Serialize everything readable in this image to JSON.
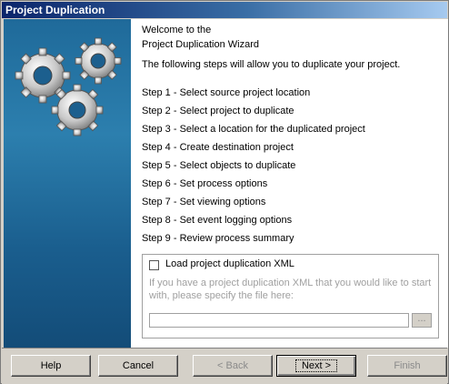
{
  "window": {
    "title": "Project Duplication"
  },
  "intro": {
    "line1": "Welcome to the",
    "line2": "Project Duplication Wizard",
    "line3": "The following steps will allow you to duplicate your project."
  },
  "steps": [
    "Step 1 - Select source project location",
    "Step 2 - Select project to duplicate",
    "Step 3 - Select a location for the duplicated project",
    "Step 4 - Create destination project",
    "Step 5 - Select objects to duplicate",
    "Step 6 - Set process options",
    "Step 7 - Set viewing options",
    "Step 8 - Set event logging options",
    "Step 9 - Review process summary"
  ],
  "xml_option": {
    "checkbox_label": "Load project duplication XML",
    "checked": false,
    "hint": "If you have a project duplication XML that you would like to start with, please specify the file here:",
    "file_path": "",
    "browse_label": "..."
  },
  "buttons": {
    "help": "Help",
    "cancel": "Cancel",
    "back": "< Back",
    "next": "Next >",
    "finish": "Finish"
  },
  "colors": {
    "title_bar": "#0a246a",
    "side_panel": "#1f6a9a",
    "gear": "#c8c8c8"
  }
}
